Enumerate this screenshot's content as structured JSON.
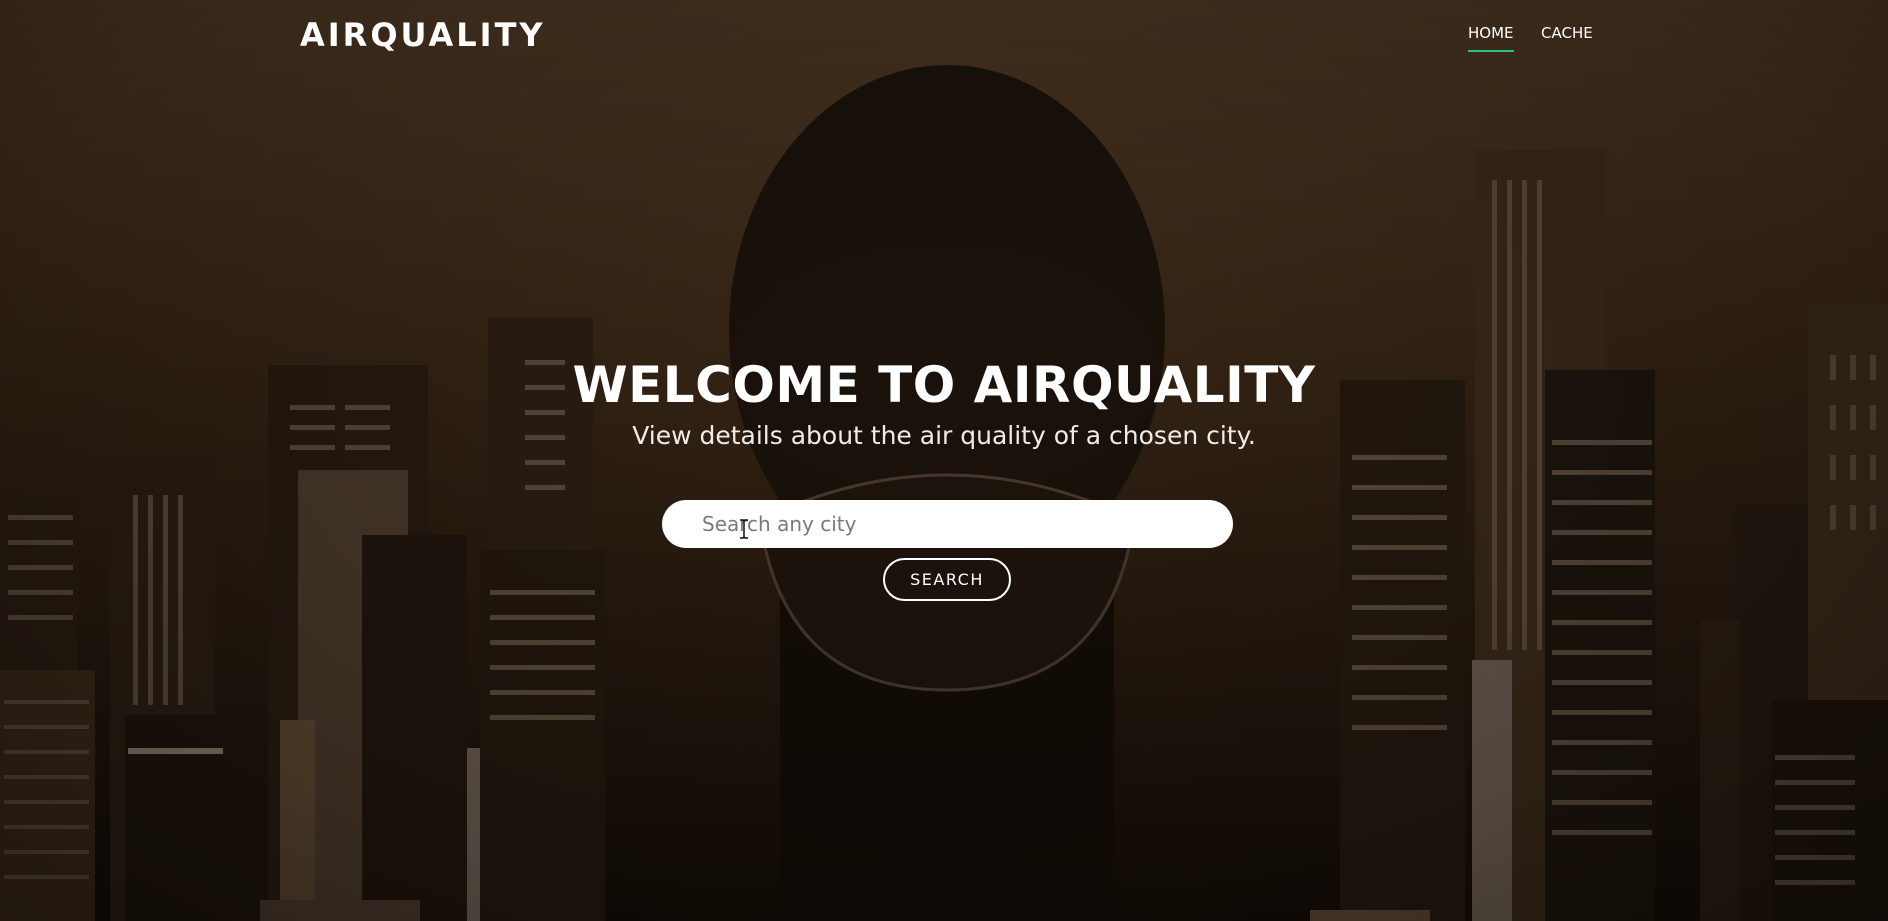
{
  "nav": {
    "brand": "AIRQUALITY",
    "links": [
      {
        "label": "HOME",
        "active": true
      },
      {
        "label": "CACHE",
        "active": false
      }
    ]
  },
  "hero": {
    "title": "WELCOME TO AIRQUALITY",
    "subtitle": "View details about the air quality of a chosen city."
  },
  "search": {
    "placeholder": "Search any city",
    "value": "",
    "button_label": "SEARCH"
  },
  "colors": {
    "active_underline": "#2ec27e",
    "background_tint": "#3a2817",
    "text": "#ffffff"
  },
  "icons": {
    "cursor": "text-cursor-icon"
  }
}
